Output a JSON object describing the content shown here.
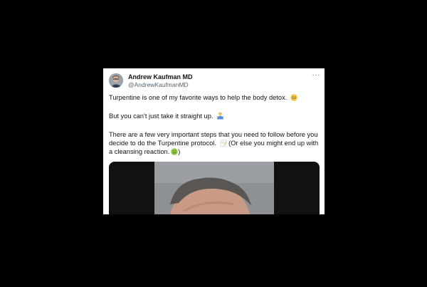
{
  "tweet": {
    "author_name": "Andrew Kaufman MD",
    "author_handle": "@AndrewKaufmanMD",
    "more_label": "···",
    "paragraph1": "Turpentine is one of my favorite ways to help the body detox.",
    "paragraph2": "But you can't just take it straight up.",
    "paragraph3a": "There are a few very important steps that you need to follow before you decide to do the Turpentine protocol.",
    "paragraph3b": "(Or else you might end up with a cleansing reaction.",
    "paragraph3c": ")",
    "emojis": [
      "grinning-face-emoji",
      "person-shrugging-emoji",
      "memo-emoji",
      "nauseated-face-emoji"
    ]
  },
  "media": {
    "type": "video",
    "icon": "video-thumbnail"
  }
}
